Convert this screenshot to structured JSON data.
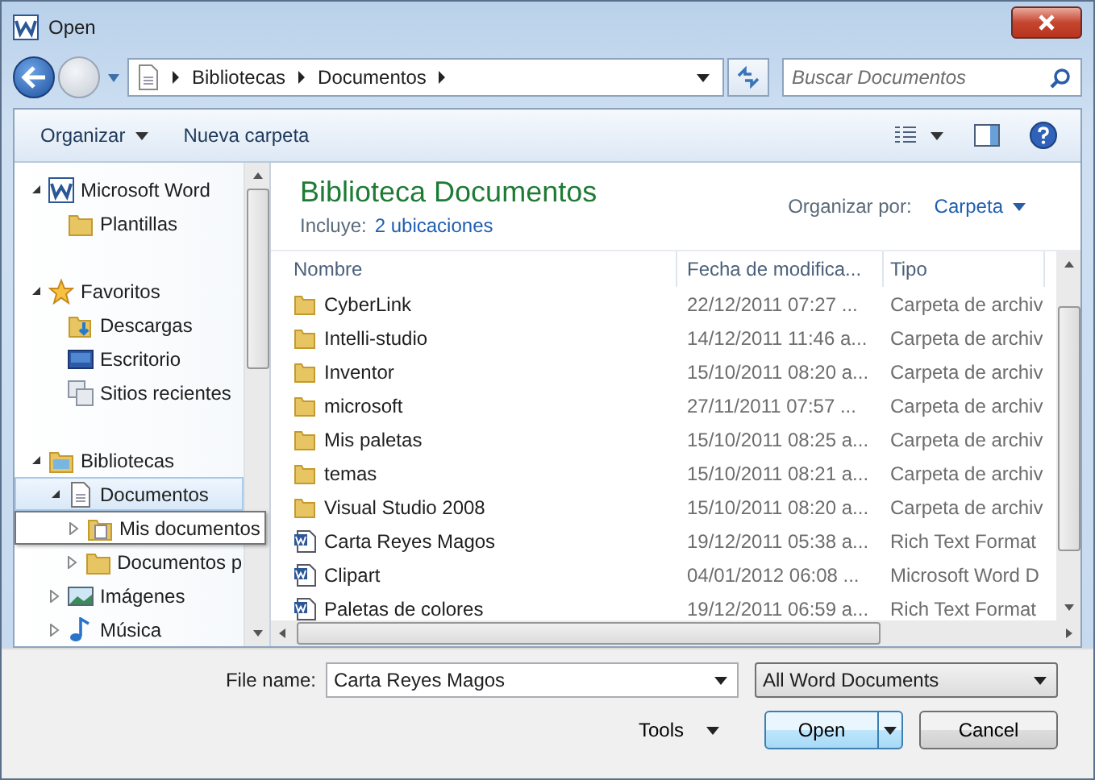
{
  "window": {
    "title": "Open"
  },
  "address": {
    "crumbs": [
      "Bibliotecas",
      "Documentos"
    ],
    "search_placeholder": "Buscar Documentos"
  },
  "toolbar": {
    "organize": "Organizar",
    "new_folder": "Nueva carpeta"
  },
  "navigation": [
    {
      "label": "Microsoft Word",
      "kind": "word",
      "expanded": true,
      "selected": false,
      "hovered": false,
      "children": [
        {
          "label": "Plantillas",
          "kind": "folder",
          "selected": false,
          "hovered": false
        }
      ]
    },
    {
      "label": "Favoritos",
      "kind": "star",
      "expanded": true,
      "selected": false,
      "hovered": false,
      "children": [
        {
          "label": "Descargas",
          "kind": "download",
          "selected": false,
          "hovered": false
        },
        {
          "label": "Escritorio",
          "kind": "desktop",
          "selected": false,
          "hovered": false
        },
        {
          "label": "Sitios recientes",
          "kind": "recent",
          "selected": false,
          "hovered": false
        }
      ]
    },
    {
      "label": "Bibliotecas",
      "kind": "library",
      "expanded": true,
      "selected": false,
      "hovered": false,
      "children": [
        {
          "label": "Documentos",
          "kind": "doclib",
          "expanded": true,
          "selected": true,
          "hovered": false,
          "children": [
            {
              "label": "Mis documentos",
              "kind": "docfolder",
              "expanded": false,
              "selected": false,
              "hovered": true
            },
            {
              "label": "Documentos p",
              "kind": "folder",
              "expanded": false,
              "selected": false,
              "hovered": false
            }
          ]
        },
        {
          "label": "Imágenes",
          "kind": "pictures",
          "expanded": false,
          "selected": false,
          "hovered": false
        },
        {
          "label": "Música",
          "kind": "music",
          "expanded": false,
          "selected": false,
          "hovered": false
        }
      ]
    }
  ],
  "library": {
    "title": "Biblioteca Documentos",
    "includes_label": "Incluye:",
    "includes_link": "2 ubicaciones",
    "arrange_label": "Organizar por:",
    "arrange_value": "Carpeta"
  },
  "table": {
    "columns": [
      "Nombre",
      "Fecha de modifica...",
      "Tipo"
    ],
    "rows": [
      {
        "name": "CyberLink",
        "date": "22/12/2011 07:27 ...",
        "type": "Carpeta de archiv",
        "kind": "folder"
      },
      {
        "name": "Intelli-studio",
        "date": "14/12/2011 11:46 a...",
        "type": "Carpeta de archiv",
        "kind": "folder"
      },
      {
        "name": "Inventor",
        "date": "15/10/2011 08:20 a...",
        "type": "Carpeta de archiv",
        "kind": "folder"
      },
      {
        "name": "microsoft",
        "date": "27/11/2011 07:57 ...",
        "type": "Carpeta de archiv",
        "kind": "folder"
      },
      {
        "name": "Mis paletas",
        "date": "15/10/2011 08:25 a...",
        "type": "Carpeta de archiv",
        "kind": "folder"
      },
      {
        "name": "temas",
        "date": "15/10/2011 08:21 a...",
        "type": "Carpeta de archiv",
        "kind": "folder"
      },
      {
        "name": "Visual Studio 2008",
        "date": "15/10/2011 08:20 a...",
        "type": "Carpeta de archiv",
        "kind": "folder"
      },
      {
        "name": "Carta Reyes Magos",
        "date": "19/12/2011 05:38 a...",
        "type": "Rich Text Format",
        "kind": "word"
      },
      {
        "name": "Clipart",
        "date": "04/01/2012 06:08 ...",
        "type": "Microsoft Word D",
        "kind": "word"
      },
      {
        "name": "Paletas de colores",
        "date": "19/12/2011 06:59 a...",
        "type": "Rich Text Format",
        "kind": "word"
      }
    ]
  },
  "footer": {
    "file_name_label": "File name:",
    "file_name": "Carta Reyes Magos",
    "filter": "All Word Documents",
    "tools": "Tools",
    "open": "Open",
    "cancel": "Cancel"
  }
}
